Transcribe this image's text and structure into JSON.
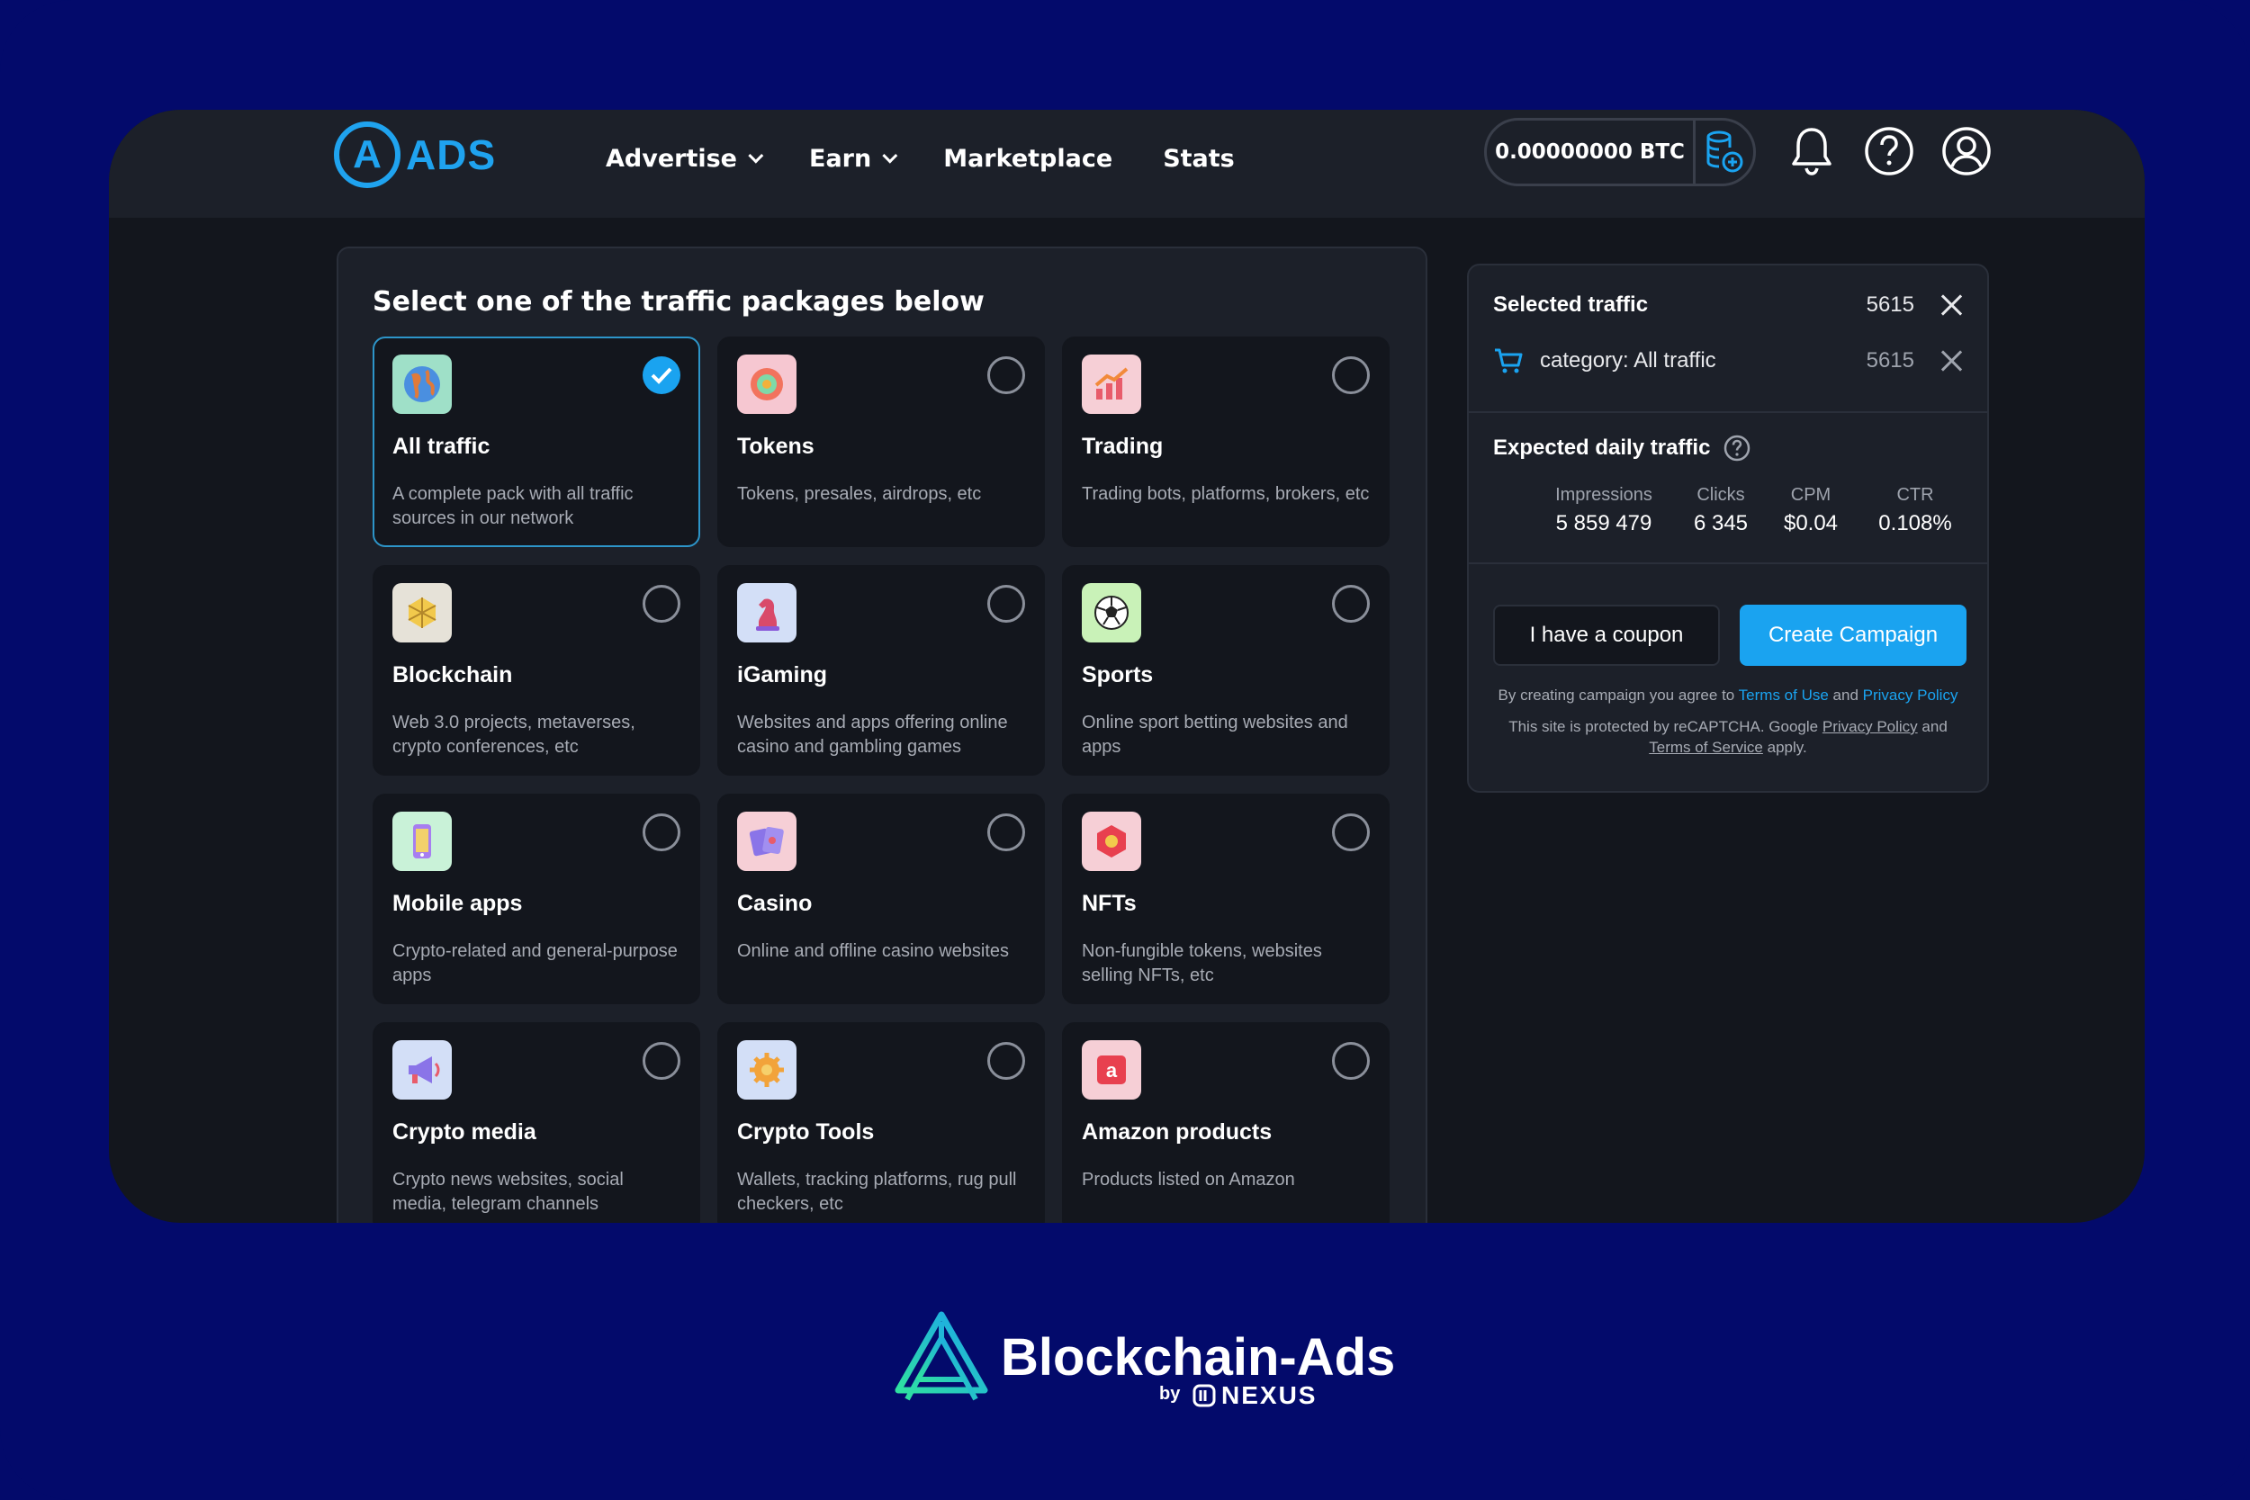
{
  "header": {
    "logo_letter": "A",
    "logo_text": "ADS",
    "nav": [
      {
        "label": "Advertise",
        "has_dropdown": true
      },
      {
        "label": "Earn",
        "has_dropdown": true
      },
      {
        "label": "Marketplace",
        "has_dropdown": false
      },
      {
        "label": "Stats",
        "has_dropdown": false
      }
    ],
    "balance": "0.00000000  BTC"
  },
  "packages": {
    "title": "Select one of the traffic packages below",
    "items": [
      {
        "title": "All traffic",
        "description": "A complete pack with all traffic sources in our network",
        "icon": "globe-icon",
        "selected": true
      },
      {
        "title": "Tokens",
        "description": "Tokens, presales, airdrops, etc",
        "icon": "token-coin-icon",
        "selected": false
      },
      {
        "title": "Trading",
        "description": "Trading bots, platforms, brokers, etc",
        "icon": "chart-up-icon",
        "selected": false
      },
      {
        "title": "Blockchain",
        "description": "Web 3.0 projects, metaverses, crypto conferences, etc",
        "icon": "blockchain-cube-icon",
        "selected": false
      },
      {
        "title": "iGaming",
        "description": "Websites and apps offering online casino and gambling games",
        "icon": "chess-knight-icon",
        "selected": false
      },
      {
        "title": "Sports",
        "description": "Online sport betting websites and apps",
        "icon": "soccer-ball-icon",
        "selected": false
      },
      {
        "title": "Mobile apps",
        "description": "Crypto-related and general-purpose apps",
        "icon": "mobile-phone-icon",
        "selected": false
      },
      {
        "title": "Casino",
        "description": "Online and offline casino websites",
        "icon": "playing-cards-icon",
        "selected": false
      },
      {
        "title": "NFTs",
        "description": "Non-fungible tokens, websites selling NFTs, etc",
        "icon": "nft-hexagon-icon",
        "selected": false
      },
      {
        "title": "Crypto media",
        "description": "Crypto news websites, social media, telegram channels",
        "icon": "megaphone-icon",
        "selected": false
      },
      {
        "title": "Crypto Tools",
        "description": "Wallets, tracking platforms, rug pull checkers, etc",
        "icon": "gear-coin-icon",
        "selected": false
      },
      {
        "title": "Amazon products",
        "description": "Products listed on Amazon",
        "icon": "amazon-box-icon",
        "selected": false
      }
    ]
  },
  "summary": {
    "selected_label": "Selected traffic",
    "selected_count": "5615",
    "category_label": "category: All traffic",
    "category_count": "5615",
    "expected_label": "Expected daily traffic",
    "stats": [
      {
        "label": "Impressions",
        "value": "5 859 479"
      },
      {
        "label": "Clicks",
        "value": "6 345"
      },
      {
        "label": "CPM",
        "value": "$0.04"
      },
      {
        "label": "CTR",
        "value": "0.108%"
      }
    ],
    "coupon_button": "I have a coupon",
    "create_button": "Create Campaign",
    "legal1_prefix": "By creating campaign you agree to",
    "terms_of_use": "Terms of Use",
    "and1": "and",
    "privacy_policy": "Privacy Policy",
    "legal2_prefix": "This site is protected by reCAPTCHA. Google",
    "privacy_policy2": "Privacy Policy",
    "and2": "and",
    "terms_of_service": "Terms of Service",
    "apply": "apply."
  },
  "brand": {
    "name": "Blockchain-Ads",
    "by": "by",
    "partner": "NEXUS"
  },
  "colors": {
    "background": "#030a6b",
    "accent": "#1aa3f0",
    "panel": "#1c2029",
    "card": "#13161d"
  }
}
